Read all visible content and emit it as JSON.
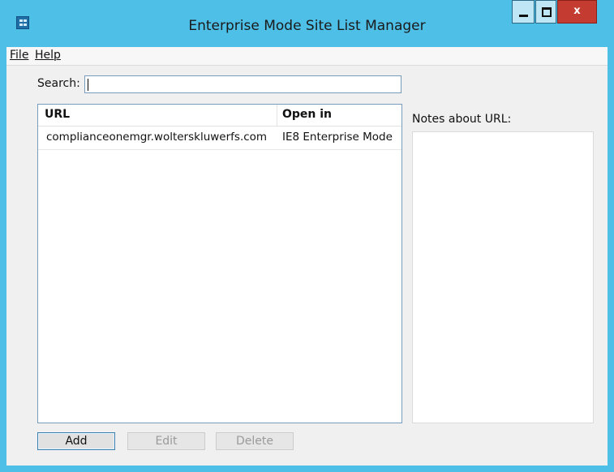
{
  "window": {
    "title": "Enterprise Mode Site List Manager",
    "controls": {
      "minimize": "minimize",
      "maximize": "maximize",
      "close_label": "x"
    },
    "colors": {
      "frame": "#4ec0e8",
      "close": "#c43b31"
    }
  },
  "menubar": {
    "items": [
      {
        "label": "File"
      },
      {
        "label": "Help"
      }
    ]
  },
  "search": {
    "label": "Search:",
    "value": ""
  },
  "table": {
    "columns": [
      "URL",
      "Open in"
    ],
    "rows": [
      {
        "url": "complianceonemgr.wolterskluwerfs.com",
        "open_in": "IE8 Enterprise Mode"
      }
    ]
  },
  "notes": {
    "label": "Notes about URL:",
    "value": ""
  },
  "buttons": {
    "add": "Add",
    "edit": "Edit",
    "delete": "Delete"
  }
}
